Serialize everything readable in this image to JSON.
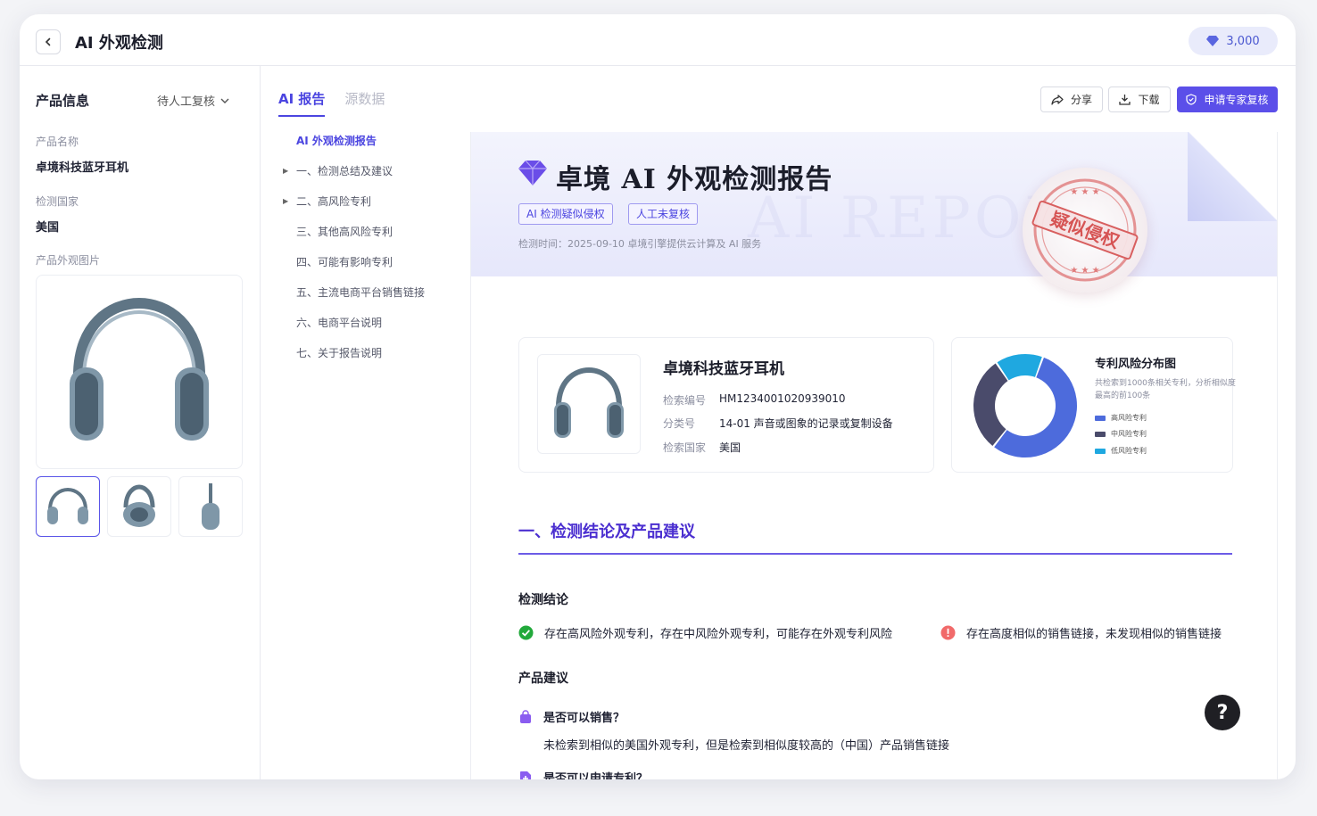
{
  "header": {
    "title": "AI 外观检测",
    "points": "3,000"
  },
  "product_panel": {
    "title": "产品信息",
    "status": "待人工复核",
    "name_label": "产品名称",
    "name_value": "卓境科技蓝牙耳机",
    "country_label": "检测国家",
    "country_value": "美国",
    "images_label": "产品外观图片"
  },
  "tabs": [
    {
      "label": "AI 报告",
      "active": true
    },
    {
      "label": "源数据",
      "active": false
    }
  ],
  "toc": [
    {
      "label": "AI 外观检测报告",
      "active": true,
      "expandable": false
    },
    {
      "label": "一、检测总结及建议",
      "active": false,
      "expandable": true
    },
    {
      "label": "二、高风险专利",
      "active": false,
      "expandable": true
    },
    {
      "label": "三、其他高风险专利",
      "active": false,
      "expandable": false
    },
    {
      "label": "四、可能有影响专利",
      "active": false,
      "expandable": false
    },
    {
      "label": "五、主流电商平台销售链接",
      "active": false,
      "expandable": false
    },
    {
      "label": "六、电商平台说明",
      "active": false,
      "expandable": false
    },
    {
      "label": "七、关于报告说明",
      "active": false,
      "expandable": false
    }
  ],
  "toolbar": {
    "share_label": "分享",
    "download_label": "下载",
    "review_label": "申请专家复核"
  },
  "report": {
    "title": "卓境   AI 外观检测报告",
    "watermark": "AI REPORT",
    "tags": [
      "AI 检测疑似侵权",
      "人工未复核"
    ],
    "meta": "检测时间：2025-09-10    卓境引擎提供云计算及 AI 服务",
    "stamp_text": "疑似侵权",
    "product": {
      "name": "卓境科技蓝牙耳机",
      "fields": [
        {
          "key": "检索编号",
          "value": "HM1234001020939010"
        },
        {
          "key": "分类号",
          "value": "14-01 声音或图象的记录或复制设备"
        },
        {
          "key": "检索国家",
          "value": "美国"
        }
      ]
    },
    "section1": {
      "title": "一、检测结论及产品建议",
      "conclusion_title": "检测结论",
      "conclusion_ok": "存在高风险外观专利，存在中风险外观专利，可能存在外观专利风险",
      "conclusion_warn": "存在高度相似的销售链接，未发现相似的销售链接",
      "suggestion_title": "产品建议",
      "q1": "是否可以销售？",
      "a1": "未检索到相似的美国外观专利，但是检索到相似度较高的（中国）产品销售链接",
      "q2": "是否可以申请专利？"
    }
  },
  "chart_data": {
    "type": "pie",
    "title": "专利风险分布图",
    "subtitle": "共检索到1000条相关专利，分析相似度最高的前100条",
    "categories": [
      "高风险专利",
      "中风险专利",
      "低风险专利"
    ],
    "values": [
      55,
      30,
      15
    ],
    "colors": [
      "#4d6bdc",
      "#4a4b6b",
      "#1fa8e0"
    ],
    "donut": true,
    "legend": "right"
  },
  "help": "?"
}
